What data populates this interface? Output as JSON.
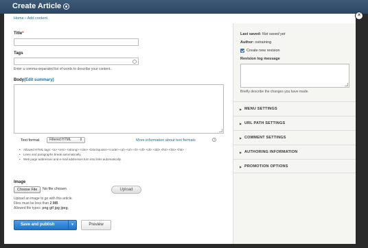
{
  "page": {
    "title": "Create Article",
    "breadcrumb": [
      "Home",
      "Add content"
    ],
    "breadcrumb_sep": "»"
  },
  "form": {
    "title_label": "Title",
    "title_required_mark": "*",
    "title_value": "",
    "tags_label": "Tags",
    "tags_value": "",
    "tags_description": "Enter a comma-separated list of words to describe your content.",
    "body_label": "Body",
    "body_edit_summary": "(Edit summary)",
    "body_value": "",
    "text_format_label": "Text format",
    "text_format_selected": "Filtered HTML",
    "text_format_more_link": "More information about text formats",
    "format_tips": [
      "Allowed HTML tags: <a> <em> <strong> <cite> <blockquote> <code> <ul> <ol> <li> <dl> <dt> <dd> <h4> <h5> <h6>",
      "Lines and paragraphs break automatically.",
      "Web page addresses and e-mail addresses turn into links automatically."
    ],
    "image_label": "Image",
    "choose_file_button": "Choose File",
    "file_status": "No file chosen",
    "upload_button": "Upload",
    "image_help_1": "Upload an image to go with this article.",
    "image_help_2_prefix": "Files must be less than",
    "image_help_2_value": "2 MB",
    "image_help_3_prefix": "Allowed file types:",
    "image_help_3_value": "png gif jpg jpeg",
    "save_button": "Save and publish",
    "preview_button": "Preview"
  },
  "sidebar": {
    "last_saved_label": "Last saved:",
    "last_saved_value": "Not saved yet",
    "author_label": "Author:",
    "author_value": "ostraining",
    "new_revision_label": "Create new revision",
    "new_revision_checked": true,
    "revision_log_label": "Revision log message",
    "revision_log_value": "",
    "revision_log_help": "Briefly describe the changes you have made.",
    "sections": [
      "MENU SETTINGS",
      "URL PATH SETTINGS",
      "COMMENT SETTINGS",
      "AUTHORING INFORMATION",
      "PROMOTION OPTIONS"
    ]
  },
  "colors": {
    "accent": "#0074bd",
    "primary_button": "#2f87d8",
    "topbar": "#34506d",
    "required": "#e32700"
  },
  "icons": {
    "shortcut": "star-circle-icon",
    "close": "close-icon",
    "autocomplete": "autocomplete-circle-icon",
    "help": "help-icon",
    "section_toggle": "triangle-right-icon",
    "dropdown": "chevron-down-icon"
  }
}
